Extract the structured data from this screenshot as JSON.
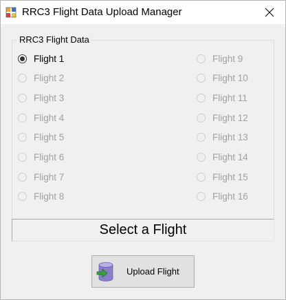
{
  "window": {
    "title": "RRC3 Flight Data Upload Manager",
    "close_glyph": "✕"
  },
  "group": {
    "legend": "RRC3 Flight Data",
    "flights_left": [
      {
        "label": "Flight 1",
        "checked": true,
        "enabled": true
      },
      {
        "label": "Flight 2",
        "checked": false,
        "enabled": false
      },
      {
        "label": "Flight 3",
        "checked": false,
        "enabled": false
      },
      {
        "label": "Flight 4",
        "checked": false,
        "enabled": false
      },
      {
        "label": "Flight 5",
        "checked": false,
        "enabled": false
      },
      {
        "label": "Flight 6",
        "checked": false,
        "enabled": false
      },
      {
        "label": "Flight 7",
        "checked": false,
        "enabled": false
      },
      {
        "label": "Flight 8",
        "checked": false,
        "enabled": false
      }
    ],
    "flights_right": [
      {
        "label": "Flight 9",
        "checked": false,
        "enabled": false
      },
      {
        "label": "Flight 10",
        "checked": false,
        "enabled": false
      },
      {
        "label": "Flight 11",
        "checked": false,
        "enabled": false
      },
      {
        "label": "Flight 12",
        "checked": false,
        "enabled": false
      },
      {
        "label": "Flight 13",
        "checked": false,
        "enabled": false
      },
      {
        "label": "Flight 14",
        "checked": false,
        "enabled": false
      },
      {
        "label": "Flight 15",
        "checked": false,
        "enabled": false
      },
      {
        "label": "Flight 16",
        "checked": false,
        "enabled": false
      }
    ]
  },
  "status": {
    "text": "Select a Flight"
  },
  "upload_button": {
    "label": "Upload Flight",
    "icon": "database-upload-icon"
  },
  "colors": {
    "window_bg": "#f0f0f0",
    "disabled_text": "#a0a0a0",
    "button_bg": "#e1e1e1",
    "icon_purple": "#8a7fc8",
    "icon_green": "#3aa23a"
  }
}
